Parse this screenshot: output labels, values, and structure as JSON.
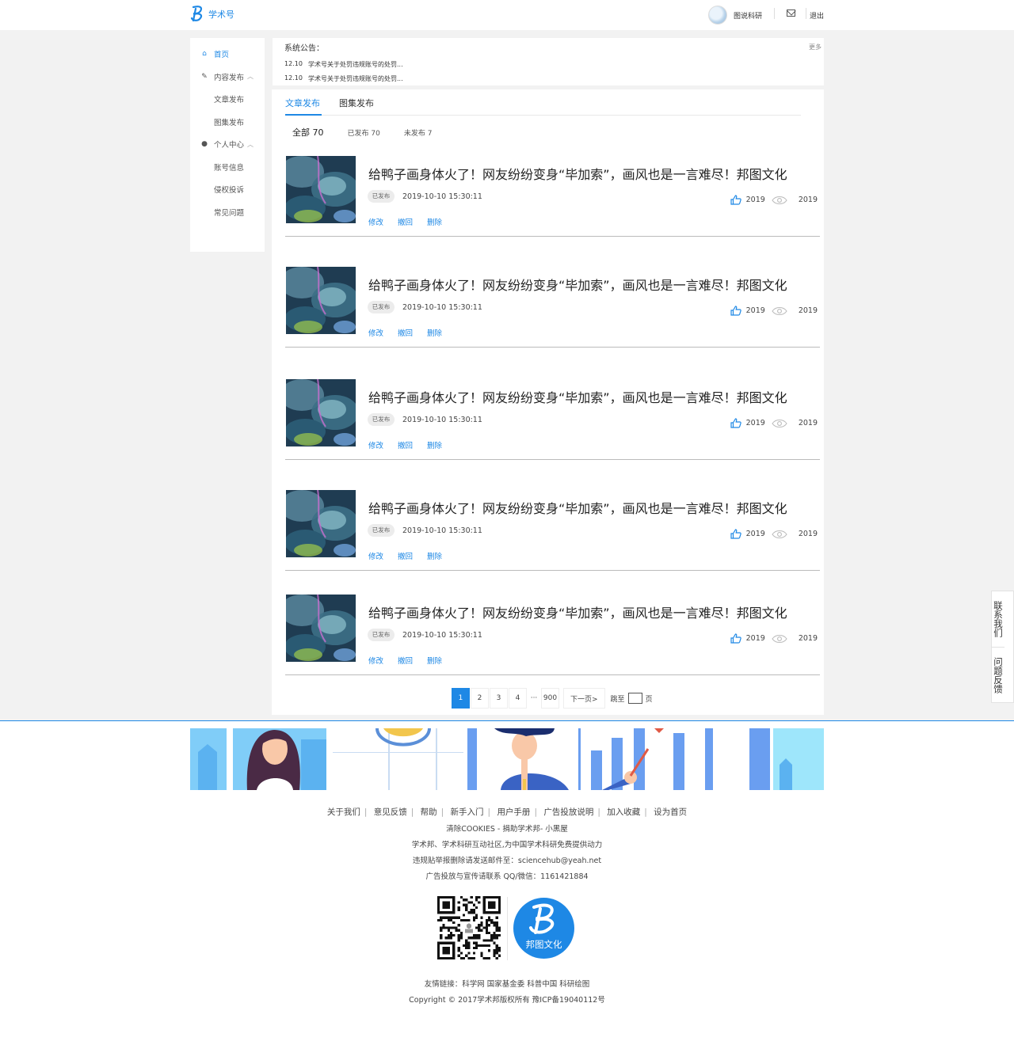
{
  "header": {
    "brand": "学术号",
    "username": "图说科研",
    "logout": "退出"
  },
  "sidebar": {
    "items": [
      {
        "label": "首页",
        "icon": "home-icon",
        "active": true,
        "sub": false
      },
      {
        "label": "内容发布",
        "icon": "pen-icon",
        "sub": false,
        "expand": true
      },
      {
        "label": "文章发布",
        "sub": true
      },
      {
        "label": "图集发布",
        "sub": true
      },
      {
        "label": "个人中心",
        "icon": "user-icon",
        "sub": false,
        "expand": true
      },
      {
        "label": "账号信息",
        "sub": true
      },
      {
        "label": "侵权投诉",
        "sub": true
      },
      {
        "label": "常见问题",
        "sub": true
      }
    ]
  },
  "notice": {
    "label": "系统公告：",
    "more": "更多",
    "items": [
      {
        "date": "12.10",
        "text": "学术号关于处罚违规账号的处罚..."
      },
      {
        "date": "12.10",
        "text": "学术号关于处罚违规账号的处罚..."
      }
    ]
  },
  "tabs": [
    "文章发布",
    "图集发布"
  ],
  "filters": [
    "全部 70",
    "已发布 70",
    "未发布 7"
  ],
  "articles": [
    {
      "title": "给鸭子画身体火了！网友纷纷变身“毕加索”，画风也是一言难尽！邦图文化",
      "status": "已发布",
      "date": "2019-10-10  15:30:11",
      "likes": "2019",
      "views": "2019"
    },
    {
      "title": "给鸭子画身体火了！网友纷纷变身“毕加索”，画风也是一言难尽！邦图文化",
      "status": "已发布",
      "date": "2019-10-10  15:30:11",
      "likes": "2019",
      "views": "2019"
    },
    {
      "title": "给鸭子画身体火了！网友纷纷变身“毕加索”，画风也是一言难尽！邦图文化",
      "status": "已发布",
      "date": "2019-10-10  15:30:11",
      "likes": "2019",
      "views": "2019"
    },
    {
      "title": "给鸭子画身体火了！网友纷纷变身“毕加索”，画风也是一言难尽！邦图文化",
      "status": "已发布",
      "date": "2019-10-10  15:30:11",
      "likes": "2019",
      "views": "2019"
    },
    {
      "title": "给鸭子画身体火了！网友纷纷变身“毕加索”，画风也是一言难尽！邦图文化",
      "status": "已发布",
      "date": "2019-10-10  15:30:11",
      "likes": "2019",
      "views": "2019"
    }
  ],
  "actions": {
    "edit": "修改",
    "revoke": "撤回",
    "delete": "删除"
  },
  "pagination": {
    "pages": [
      "1",
      "2",
      "3",
      "4"
    ],
    "ellipsis": "···",
    "last": "900",
    "next": "下一页>",
    "jump_prefix": "跳至",
    "jump_suffix": "页"
  },
  "float": {
    "contact": "联系我们",
    "feedback": "问题反馈"
  },
  "footer": {
    "links": [
      "关于我们",
      "意见反馈",
      "帮助",
      "新手入门",
      "用户手册",
      "广告投放说明",
      "加入收藏",
      "设为首页"
    ],
    "line1": "清除COOKIES - 捐助学术邦- 小黑屋",
    "line2": "学术邦、学术科研互动社区,为中国学术科研免费提供动力",
    "line3": "违规贴举报删除请发送邮件至：sciencehub@yeah.net",
    "line4": "广告投放与宣传请联系 QQ/微信：1161421884",
    "brand_logo_text": "邦图文化",
    "friend_links": "友情链接：科学网    国家基金委    科普中国  科研绘图",
    "copyright": "Copyright © 2017学术邦版权所有  豫ICP备19040112号"
  },
  "colors": {
    "accent": "#1e88e5"
  }
}
